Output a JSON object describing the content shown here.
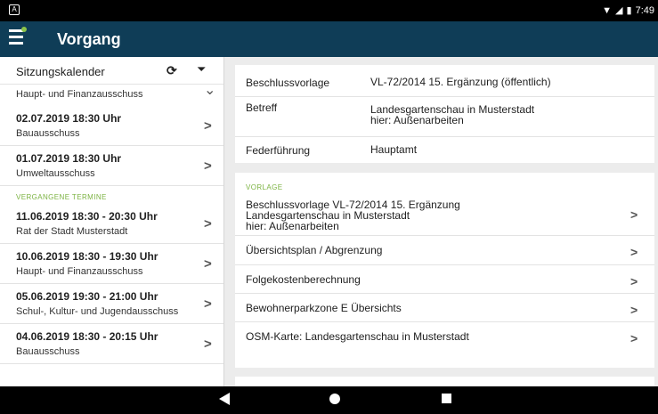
{
  "status_bar": {
    "left_icon": "A",
    "time": "7:49"
  },
  "app_bar": {
    "title": "Vorgang"
  },
  "left": {
    "header_label": "Sitzungskalender",
    "cutoff_item_sub": "Haupt- und Finanzausschuss",
    "upcoming": [
      {
        "date": "02.07.2019 18:30 Uhr",
        "committee": "Bauausschuss"
      },
      {
        "date": "01.07.2019 18:30 Uhr",
        "committee": "Umweltausschuss"
      }
    ],
    "past_header": "VERGANGENE TERMINE",
    "past": [
      {
        "date": "11.06.2019 18:30 - 20:30 Uhr",
        "committee": "Rat der Stadt Musterstadt"
      },
      {
        "date": "10.06.2019 18:30 - 19:30 Uhr",
        "committee": "Haupt- und Finanzausschuss"
      },
      {
        "date": "05.06.2019 19:30 - 21:00 Uhr",
        "committee": "Schul-, Kultur- und Jugendausschuss"
      },
      {
        "date": "04.06.2019 18:30 - 20:15 Uhr",
        "committee": "Bauausschuss"
      }
    ]
  },
  "details": {
    "beschlussvorlage": {
      "label": "Beschlussvorlage",
      "value": "VL-72/2014 15. Ergänzung (öffentlich)"
    },
    "betreff": {
      "label": "Betreff",
      "value_line1": "Landesgartenschau in Musterstadt",
      "value_line2": "hier: Außenarbeiten"
    },
    "federfuehrung": {
      "label": "Federführung",
      "value": "Hauptamt"
    }
  },
  "vorlage": {
    "section_label": "VORLAGE",
    "main_doc": {
      "line1": "Beschlussvorlage VL-72/2014 15. Ergänzung",
      "line2": "Landesgartenschau in Musterstadt",
      "line3": "hier: Außenarbeiten"
    },
    "docs": [
      "Übersichtsplan / Abgrenzung",
      "Folgekostenberechnung",
      "Bewohnerparkzone E Übersichts",
      "OSM-Karte: Landesgartenschau in Musterstadt"
    ]
  },
  "icons": {
    "menu": "hamburger-icon",
    "refresh": "refresh-icon",
    "filter": "filter-icon",
    "chevron": "chevron-right-icon",
    "wifi": "wifi-icon",
    "signal": "signal-icon",
    "battery": "battery-icon"
  },
  "colors": {
    "app_bar": "#0f3d57",
    "accent": "#7cb342",
    "status_bar": "#000000"
  }
}
